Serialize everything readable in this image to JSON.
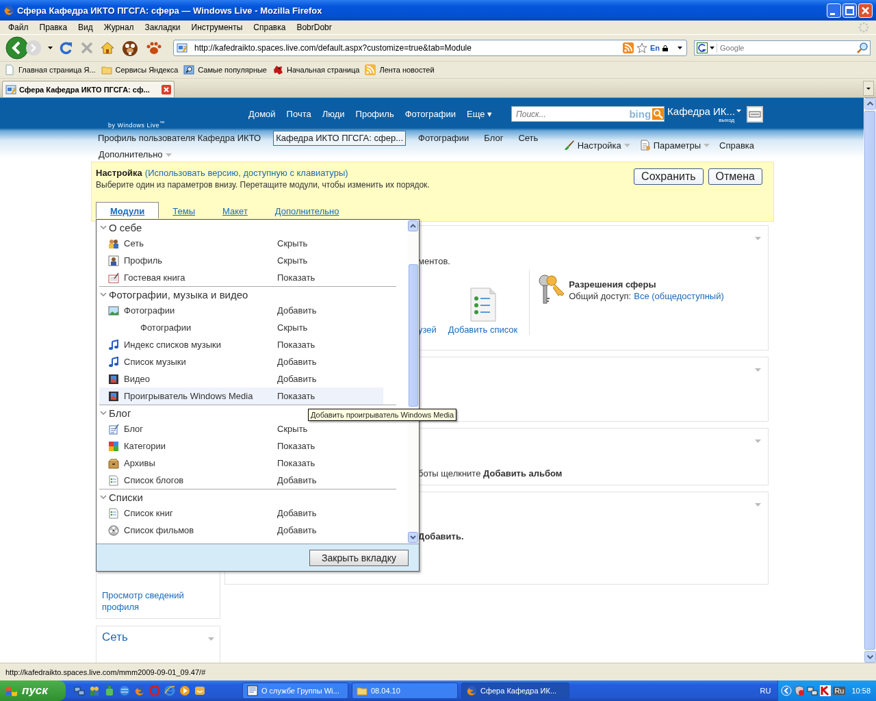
{
  "window": {
    "title": "Сфера Кафедра ИКТО ПГСГА: сфера — Windows Live - Mozilla Firefox"
  },
  "menu": [
    "Файл",
    "Правка",
    "Вид",
    "Журнал",
    "Закладки",
    "Инструменты",
    "Справка",
    "BobrDobr"
  ],
  "address": {
    "value": "http://kafedraikto.spaces.live.com/default.aspx?customize=true&tab=Module",
    "lang": "En"
  },
  "search": {
    "placeholder": "Google"
  },
  "bookmarks": [
    "Главная страница Я...",
    "Сервисы Яндекса",
    "Самые популярные",
    "Начальная страница",
    "Лента новостей"
  ],
  "tabs": [
    {
      "label": "Сфера Кафедра ИКТО ПГСГА: сф...",
      "selected": true
    }
  ],
  "site": {
    "brand": "by Windows Live$^{™}$",
    "nav": [
      "Домой",
      "Почта",
      "Люди",
      "Профиль",
      "Фотографии",
      "Еще ▾"
    ],
    "search_placeholder": "Поиск...",
    "search_logo": "bing",
    "user": "Кафедра ИК...",
    "signout": "выход",
    "subnav": [
      {
        "label": "Профиль пользователя Кафедра ИКТО",
        "selected": false
      },
      {
        "label": "Кафедра ИКТО ПГСГА: сфер...",
        "selected": true
      },
      {
        "label": "Фотографии",
        "selected": false
      },
      {
        "label": "Блог",
        "selected": false
      },
      {
        "label": "Сеть",
        "selected": false
      }
    ],
    "more": "Дополнительно",
    "tools": [
      "Настройка",
      "Параметры",
      "Справка"
    ]
  },
  "customize": {
    "title": "Настройка",
    "link": "(Использовать версию, доступную с клавиатуры)",
    "hint": "Выберите один из параметров внизу. Перетащите модули, чтобы изменить их порядок.",
    "buttons": [
      "Сохранить",
      "Отмена"
    ],
    "tabs": [
      {
        "label": "Модули",
        "selected": true
      },
      {
        "label": "Темы",
        "selected": false
      },
      {
        "label": "Макет",
        "selected": false
      },
      {
        "label": "Дополнительно",
        "selected": false
      }
    ]
  },
  "modules": {
    "groups": [
      {
        "title": "О себе",
        "rows": [
          {
            "name": "Сеть",
            "action": "Скрыть",
            "selected": false
          },
          {
            "name": "Профиль",
            "action": "Скрыть",
            "selected": false
          },
          {
            "name": "Гостевая книга",
            "action": "Показать",
            "selected": false
          }
        ]
      },
      {
        "title": "Фотографии, музыка и видео",
        "rows": [
          {
            "name": "Фотографии",
            "action": "Добавить",
            "selected": false,
            "children": [
              {
                "name": "Фотографии",
                "action": "Скрыть",
                "selected": false
              }
            ]
          },
          {
            "name": "Индекс списков музыки",
            "action": "Показать",
            "selected": false
          },
          {
            "name": "Список музыки",
            "action": "Добавить",
            "selected": false
          },
          {
            "name": "Видео",
            "action": "Добавить",
            "selected": false
          },
          {
            "name": "Проигрыватель Windows Media",
            "action": "Показать",
            "selected": true
          }
        ]
      },
      {
        "title": "Блог",
        "rows": [
          {
            "name": "Блог",
            "action": "Скрыть",
            "selected": false
          },
          {
            "name": "Категории",
            "action": "Показать",
            "selected": false
          },
          {
            "name": "Архивы",
            "action": "Показать",
            "selected": false
          },
          {
            "name": "Список блогов",
            "action": "Добавить",
            "selected": false
          }
        ]
      },
      {
        "title": "Списки",
        "rows": [
          {
            "name": "Список книг",
            "action": "Добавить",
            "selected": false
          },
          {
            "name": "Список фильмов",
            "action": "Добавить",
            "selected": false
          }
        ]
      }
    ],
    "close": "Закрыть вкладку"
  },
  "tooltip": "Добавить проигрыватель Windows Media",
  "background": {
    "card1_fragment": "ментов.",
    "link_fragment": "узей",
    "add_list": "Добавить список",
    "permissions_title": "Разрешения сферы",
    "access_label": "Общий доступ:",
    "access_value": "Все (общедоступный)",
    "card3_text": "боты щелкните **Добавить альбом**",
    "card4_text": "Добавить.",
    "profile_link": "Просмотр сведений профиля",
    "network_title": "Сеть"
  },
  "status_bar": "http://kafedraikto.spaces.live.com/mmm2009-09-01_09.47/#",
  "taskbar": {
    "start": "пуск",
    "tasks": [
      {
        "label": "О службе Группы Wi...",
        "selected": false
      },
      {
        "label": "08.04.10",
        "selected": false
      },
      {
        "label": "Сфера Кафедра ИК...",
        "selected": true
      }
    ],
    "lang": "RU",
    "tray_lang": "Ru",
    "clock": "10:58"
  }
}
